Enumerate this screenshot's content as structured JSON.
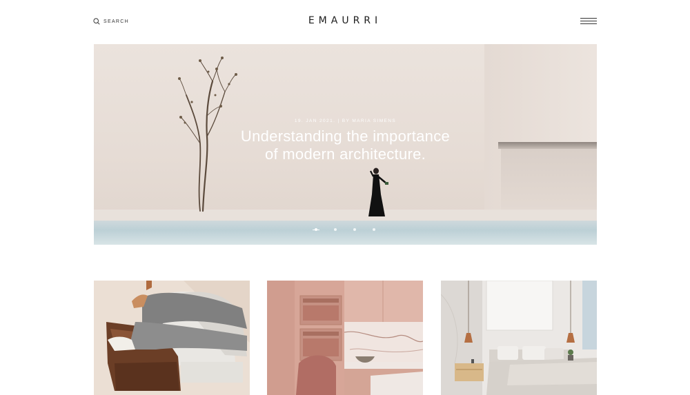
{
  "header": {
    "search_label": "SEARCH",
    "logo": "EMAURRI"
  },
  "hero": {
    "meta": "19. JAN 2021. | BY MARIA SIMENS",
    "title_line1": "Understanding the importance",
    "title_line2": "of modern architecture.",
    "slider_total": 4,
    "slider_active": 1
  },
  "cards": [
    {
      "image": "lounge-chair-with-legs"
    },
    {
      "image": "pink-kitchen-with-marble"
    },
    {
      "image": "bedroom-with-pendant-lamps"
    }
  ],
  "icons": {
    "search": "search-icon",
    "menu": "hamburger-menu-icon"
  },
  "colors": {
    "background": "#ffffff",
    "text": "#1c1c1c",
    "hero_text": "#ffffff"
  }
}
